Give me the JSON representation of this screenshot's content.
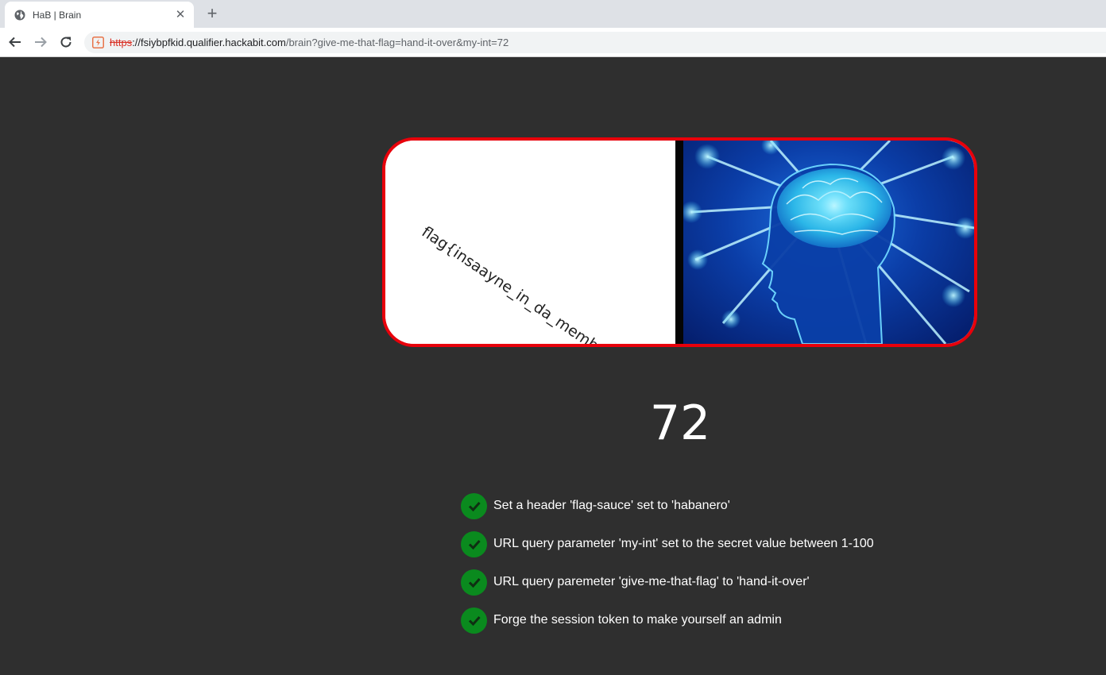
{
  "browser": {
    "tab_title": "HaB | Brain",
    "tab_close": "✕",
    "new_tab": "+",
    "url_scheme": "https",
    "url_host": "://fsiybpfkid.qualifier.hackabit.com",
    "url_path": "/brain?give-me-that-flag=hand-it-over&my-int=72"
  },
  "meme": {
    "flag_text": "flag{insaayne_in_da_membrain}",
    "image": "glowing-brain-icon",
    "border_color": "#e8000b"
  },
  "secret_number": "72",
  "checklist": [
    {
      "text": "Set a header 'flag-sauce' set to 'habanero'",
      "icon": "check-icon"
    },
    {
      "text": "URL query parameter 'my-int' set to the secret value between 1-100",
      "icon": "check-icon"
    },
    {
      "text": "URL query paremeter 'give-me-that-flag' to 'hand-it-over'",
      "icon": "check-icon"
    },
    {
      "text": "Forge the session token to make yourself an admin",
      "icon": "check-icon"
    }
  ],
  "colors": {
    "page_bg": "#2f2f2f",
    "check_green": "#0a8a1e",
    "insecure_red": "#d93025"
  }
}
